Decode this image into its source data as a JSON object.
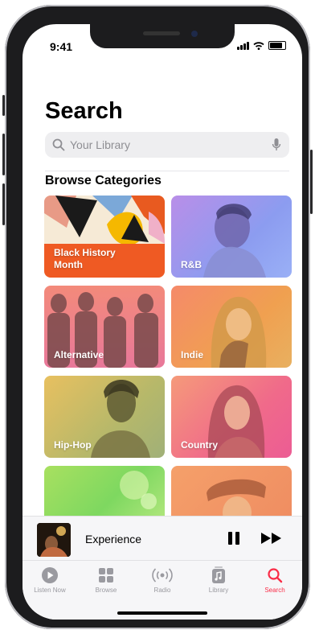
{
  "status": {
    "time": "9:41"
  },
  "page": {
    "title": "Search",
    "section_title": "Browse Categories"
  },
  "search": {
    "placeholder": "Your Library"
  },
  "categories": [
    {
      "label_line1": "Black History",
      "label_line2": "Month"
    },
    {
      "label_line1": "R&B",
      "label_line2": ""
    },
    {
      "label_line1": "Alternative",
      "label_line2": ""
    },
    {
      "label_line1": "Indie",
      "label_line2": ""
    },
    {
      "label_line1": "Hip-Hop",
      "label_line2": ""
    },
    {
      "label_line1": "Country",
      "label_line2": ""
    },
    {
      "label_line1": "",
      "label_line2": ""
    },
    {
      "label_line1": "",
      "label_line2": ""
    }
  ],
  "now_playing": {
    "title": "Experience"
  },
  "tabs": [
    {
      "label": "Listen Now",
      "icon": "play-circle-icon"
    },
    {
      "label": "Browse",
      "icon": "grid-icon"
    },
    {
      "label": "Radio",
      "icon": "radio-waves-icon"
    },
    {
      "label": "Library",
      "icon": "music-note-icon"
    },
    {
      "label": "Search",
      "icon": "search-icon"
    }
  ],
  "colors": {
    "accent": "#fa2d48",
    "inactive": "#9a9aa0"
  }
}
